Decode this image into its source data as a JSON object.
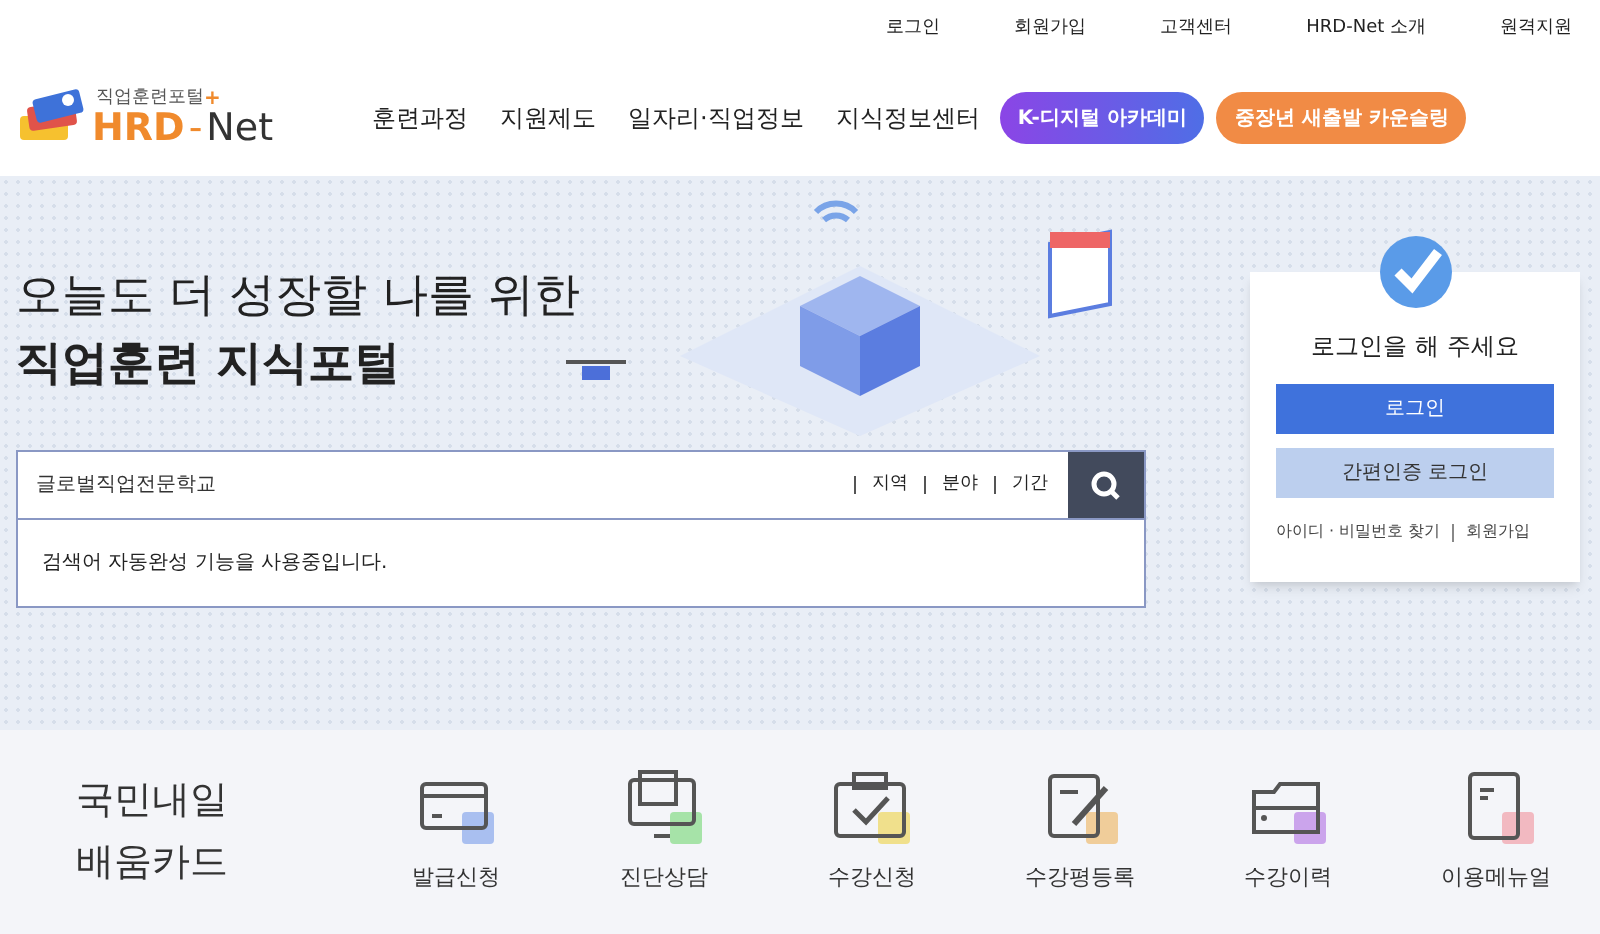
{
  "top_links": [
    "로그인",
    "회원가입",
    "고객센터",
    "HRD-Net 소개",
    "원격지원"
  ],
  "logo": {
    "subtitle": "직업훈련포털",
    "plus": "+",
    "name_a": "HRD",
    "dash": "-",
    "name_b": "Net"
  },
  "nav": [
    "훈련과정",
    "지원제도",
    "일자리·직업정보",
    "지식정보센터"
  ],
  "nav_buttons": [
    {
      "label": "K-디지털 아카데미",
      "kind": "purple"
    },
    {
      "label": "중장년 새출발 카운슬링",
      "kind": "orange"
    }
  ],
  "hero": {
    "line1": "오늘도 더 성장할 나를 위한",
    "line2": "직업훈련 지식포털"
  },
  "search": {
    "value": "글로벌직업전문학교",
    "filters": [
      "지역",
      "분야",
      "기간"
    ],
    "autocomplete": "검색어 자동완성 기능을 사용중입니다."
  },
  "login_box": {
    "title": "로그인을 해 주세요",
    "login": "로그인",
    "easy_login": "간편인증 로그인",
    "find": "아이디 · 비밀번호 찾기",
    "join": "회원가입"
  },
  "card": {
    "title_1": "국민내일",
    "title_2": "배움카드"
  },
  "card_menu": [
    {
      "label": "발급신청",
      "kind": "card",
      "color": "#a9bff0"
    },
    {
      "label": "진단상담",
      "kind": "monitor",
      "color": "#a6e3a8"
    },
    {
      "label": "수강신청",
      "kind": "clipboard",
      "color": "#f0e08c"
    },
    {
      "label": "수강평등록",
      "kind": "pen",
      "color": "#f0cd9a"
    },
    {
      "label": "수강이력",
      "kind": "folder",
      "color": "#cba4ec"
    },
    {
      "label": "이용메뉴얼",
      "kind": "book",
      "color": "#f2b9c1"
    }
  ]
}
